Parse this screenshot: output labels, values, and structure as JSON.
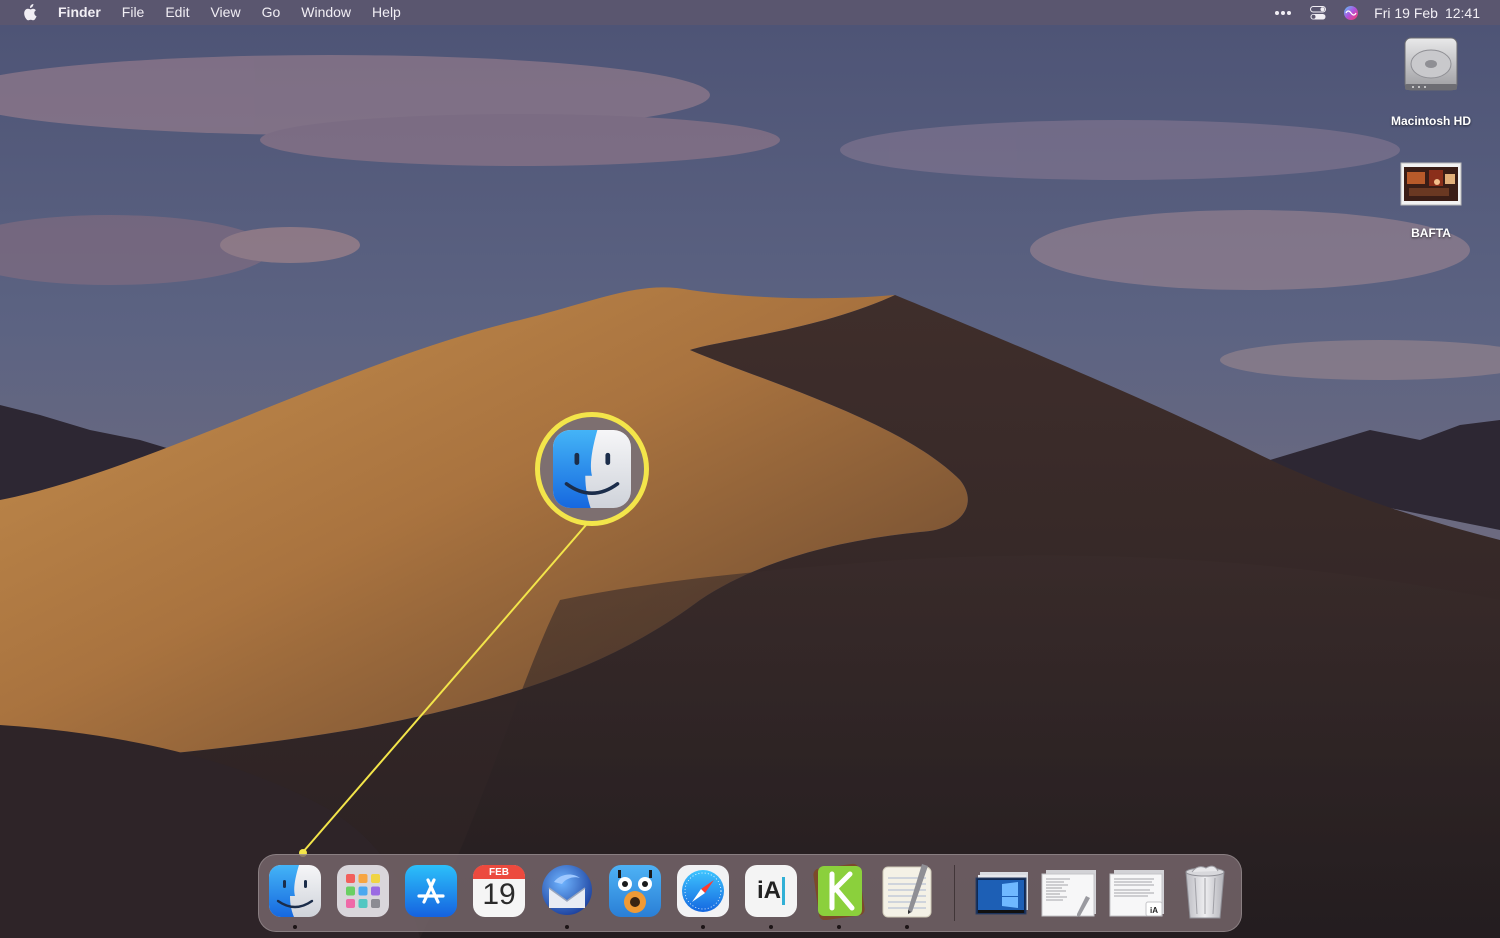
{
  "menubar": {
    "app_name": "Finder",
    "items": [
      "File",
      "Edit",
      "View",
      "Go",
      "Window",
      "Help"
    ],
    "icons": [
      "apple-logo-icon",
      "more-icon",
      "control-center-icon",
      "siri-icon"
    ],
    "date": "Fri 19 Feb",
    "time": "12:41"
  },
  "desktop": {
    "icons": [
      {
        "label": "Macintosh HD",
        "icon": "hard-drive-icon"
      },
      {
        "label": "BAFTA",
        "icon": "image-file-icon"
      }
    ]
  },
  "callout": {
    "icon": "finder-icon",
    "color": "#f3e54a"
  },
  "dock": {
    "apps": [
      {
        "name": "Finder",
        "icon": "finder-icon",
        "running": true
      },
      {
        "name": "Launchpad",
        "icon": "launchpad-icon",
        "running": false
      },
      {
        "name": "App Store",
        "icon": "app-store-icon",
        "running": false
      },
      {
        "name": "Calendar",
        "icon": "calendar-icon",
        "running": false
      },
      {
        "name": "Thunderbird",
        "icon": "thunderbird-icon",
        "running": true
      },
      {
        "name": "Tweetbot",
        "icon": "tweetbot-icon",
        "running": false
      },
      {
        "name": "Safari",
        "icon": "safari-icon",
        "running": true
      },
      {
        "name": "iA Writer",
        "icon": "ia-writer-icon",
        "running": true
      },
      {
        "name": "Klokki",
        "icon": "klokki-icon",
        "running": true
      },
      {
        "name": "TextEdit",
        "icon": "textedit-icon",
        "running": true
      }
    ],
    "calendar_month": "FEB",
    "calendar_day": "19",
    "ia_label": "iA",
    "recent": [
      {
        "icon": "screenshot-thumbnail-icon"
      },
      {
        "icon": "document-thumbnail-icon"
      },
      {
        "icon": "ia-document-thumbnail-icon"
      },
      {
        "icon": "trash-icon"
      }
    ]
  }
}
